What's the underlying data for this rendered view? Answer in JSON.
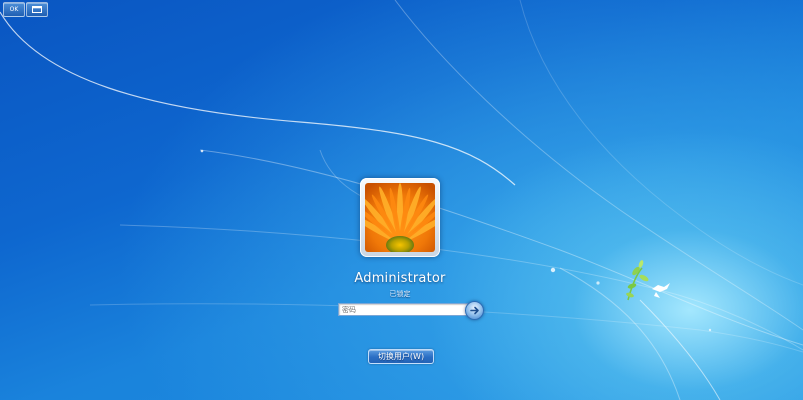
{
  "toolbar": {
    "left_button_label": "OK",
    "left_button_icon": "keyboard-icon",
    "right_button_icon": "window-icon"
  },
  "account": {
    "username": "Administrator",
    "status": "已锁定",
    "avatar_icon": "orange-flower-picture"
  },
  "login": {
    "password_placeholder": "密码",
    "submit_icon": "arrow-right-icon"
  },
  "actions": {
    "switch_user_label": "切换用户(W)"
  },
  "colors": {
    "background_deep": "#0a56c2",
    "background_light": "#aaebff",
    "button_blue": "#2a6ec4"
  }
}
